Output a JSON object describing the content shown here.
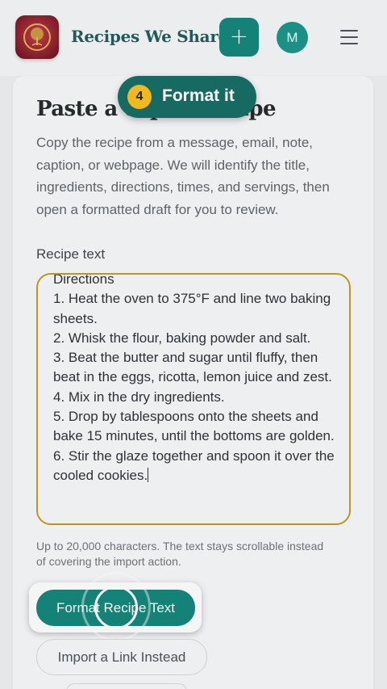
{
  "header": {
    "app_title": "Recipes We Share",
    "add_label": "+",
    "avatar_initial": "M"
  },
  "page": {
    "title": "Paste a copied recipe",
    "description": "Copy the recipe from a message, email, note, caption, or webpage. We will identify the title, ingredients, directions, times, and servings, then open a formatted draft for you to review.",
    "field_label": "Recipe text",
    "textarea_value": "Directions\n1. Heat the oven to 375°F and line two baking sheets.\n2. Whisk the flour, baking powder and salt.\n3. Beat the butter and sugar until fluffy, then beat in the eggs, ricotta, lemon juice and zest.\n4. Mix in the dry ingredients.\n5. Drop by tablespoons onto the sheets and bake 15 minutes, until the bottoms are golden.\n6. Stir the glaze together and spoon it over the cooled cookies.",
    "hint": "Up to 20,000 characters. The text stays scrollable instead of covering the import action.",
    "format_button": "Format Recipe Text",
    "link_button": "Import a Link Instead"
  },
  "tour": {
    "step_number": "4",
    "step_label": "Format it"
  },
  "colors": {
    "brand_teal": "#10857a",
    "title_teal": "#1f5a5b",
    "tour_pill": "#166a62",
    "step_badge": "#f2b81f",
    "focus_border": "#c69a1e"
  }
}
